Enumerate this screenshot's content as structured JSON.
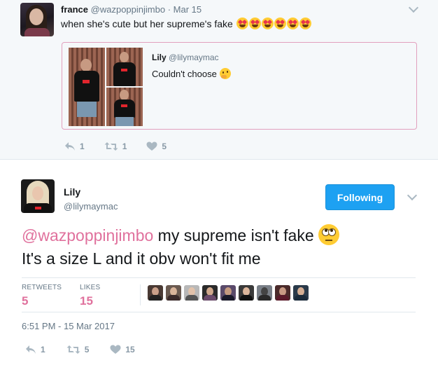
{
  "reply_tweet": {
    "author_name": "france",
    "author_handle": "@wazpoppinjimbo",
    "separator": "·",
    "date": "Mar 15",
    "text": "when she's cute but her supreme's fake",
    "emoji_count": 6,
    "quoted_tweet": {
      "author_name": "Lily",
      "author_handle": "@lilymaymac",
      "text": "Couldn't choose"
    },
    "actions": {
      "reply_count": "1",
      "retweet_count": "1",
      "like_count": "5"
    }
  },
  "main_tweet": {
    "author_name": "Lily",
    "author_handle": "@lilymaymac",
    "follow_button_label": "Following",
    "mention": "@wazpoppinjimbo",
    "text_line1_rest": " my supreme isn't fake",
    "text_line2": "It's a size L and it obv won't fit me",
    "stats": {
      "retweets_label": "RETWEETS",
      "retweets_value": "5",
      "likes_label": "LIKES",
      "likes_value": "15"
    },
    "liker_avatar_count": 9,
    "timestamp": "6:51 PM - 15 Mar 2017",
    "actions": {
      "reply_count": "1",
      "retweet_count": "5",
      "like_count": "15"
    }
  },
  "colors": {
    "accent_link": "#e0719d",
    "follow_button": "#1da1f2",
    "quote_border": "#e2a0bd",
    "muted_text": "#657786",
    "icon_gray": "#aab8c2"
  },
  "icons": [
    "reply-icon",
    "retweet-icon",
    "heart-icon",
    "chevron-down-icon"
  ]
}
